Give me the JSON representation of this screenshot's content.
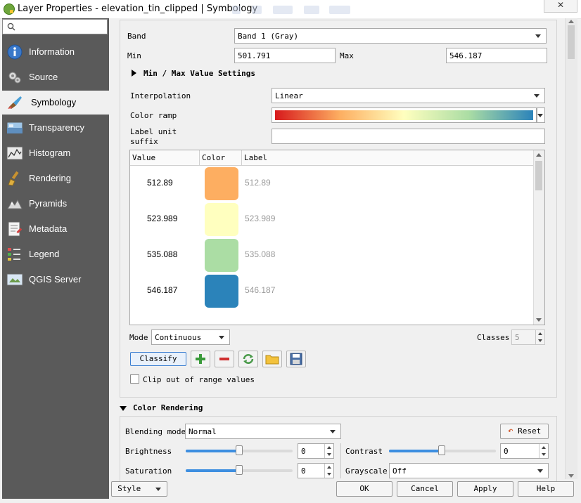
{
  "window": {
    "title": "Layer Properties - elevation_tin_clipped | Symbology",
    "close_label": "✕"
  },
  "sidebar": {
    "search_placeholder": "",
    "items": [
      {
        "label": "Information",
        "icon": "info-icon"
      },
      {
        "label": "Source",
        "icon": "source-icon"
      },
      {
        "label": "Symbology",
        "icon": "symbology-icon",
        "active": true
      },
      {
        "label": "Transparency",
        "icon": "transparency-icon"
      },
      {
        "label": "Histogram",
        "icon": "histogram-icon"
      },
      {
        "label": "Rendering",
        "icon": "rendering-icon"
      },
      {
        "label": "Pyramids",
        "icon": "pyramids-icon"
      },
      {
        "label": "Metadata",
        "icon": "metadata-icon"
      },
      {
        "label": "Legend",
        "icon": "legend-icon"
      },
      {
        "label": "QGIS Server",
        "icon": "qgis-server-icon"
      }
    ]
  },
  "band": {
    "label": "Band",
    "value": "Band 1 (Gray)"
  },
  "minmax": {
    "min_label": "Min",
    "min_value": "501.791",
    "max_label": "Max",
    "max_value": "546.187"
  },
  "minmax_settings_label": "Min / Max Value Settings",
  "interpolation": {
    "label": "Interpolation",
    "value": "Linear"
  },
  "color_ramp": {
    "label": "Color ramp",
    "colors": [
      "#d7191c",
      "#fdae61",
      "#ffffbf",
      "#abdda4",
      "#2b83ba"
    ]
  },
  "label_unit_suffix": {
    "label_line1": "Label unit",
    "label_line2": "suffix",
    "value": ""
  },
  "table": {
    "headers": [
      "Value",
      "Color",
      "Label"
    ],
    "rows": [
      {
        "value": "512.89",
        "color": "#fdae61",
        "label": "512.89"
      },
      {
        "value": "523.989",
        "color": "#ffffbf",
        "label": "523.989"
      },
      {
        "value": "535.088",
        "color": "#abdda4",
        "label": "535.088"
      },
      {
        "value": "546.187",
        "color": "#2b83ba",
        "label": "546.187"
      }
    ]
  },
  "mode": {
    "label": "Mode",
    "value": "Continuous"
  },
  "classes": {
    "label": "Classes",
    "value": "5"
  },
  "classify_label": "Classify",
  "clip_label": "Clip out of range values",
  "color_rendering": {
    "title": "Color Rendering",
    "blending_label": "Blending mode",
    "blending_value": "Normal",
    "reset_label": "Reset",
    "brightness_label": "Brightness",
    "brightness_value": "0",
    "contrast_label": "Contrast",
    "contrast_value": "0",
    "saturation_label": "Saturation",
    "saturation_value": "0",
    "grayscale_label": "Grayscale",
    "grayscale_value": "Off"
  },
  "footer": {
    "style": "Style",
    "ok": "OK",
    "cancel": "Cancel",
    "apply": "Apply",
    "help": "Help"
  }
}
